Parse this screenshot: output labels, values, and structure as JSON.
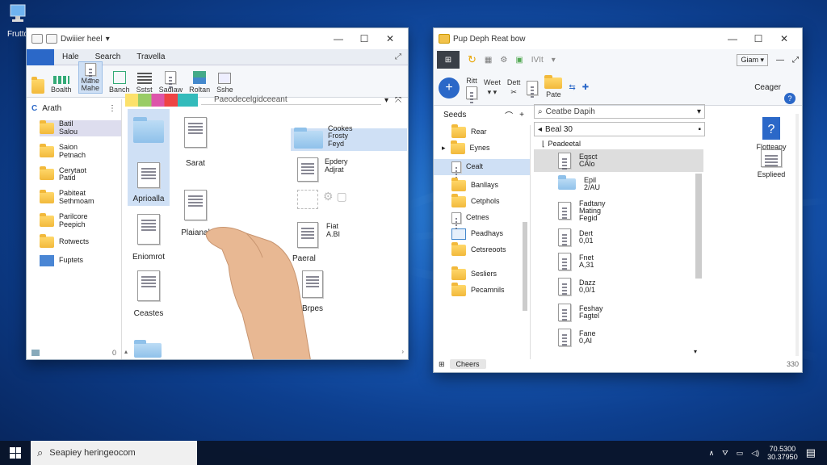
{
  "desktop": {
    "icons": [
      {
        "label": "Fruttd"
      }
    ]
  },
  "left_window": {
    "title": "Dwiiier heel",
    "tabs": [
      "Hale",
      "Search",
      "Travella"
    ],
    "ribbon": [
      "Boalth",
      "Mane\nMahe",
      "Banch",
      "Sstst",
      "Sadlaw",
      "Roltan",
      "Sshe"
    ],
    "address": "Paeodecelgidceeant",
    "nav_header": "Arath",
    "sidebar": [
      "Batil\nSalou",
      "Saion\nPetnach",
      "Cerytaot\nPatid",
      "Pabiteat\nSethmoam",
      "Parilcore\nPeepich",
      "Rotwects",
      "Fuptets"
    ],
    "files": [
      {
        "label": "Aprioalla"
      },
      {
        "label": "Sarat"
      },
      {
        "label": "Plaianal"
      },
      {
        "label": "Eniomrot"
      },
      {
        "label": "Ceastes"
      },
      {
        "label": "Cookes\nFrosty\nFeyd"
      },
      {
        "label": "Epdery\nAdjrat"
      },
      {
        "label": "Fiat\nA.BI"
      },
      {
        "label": "Paeral"
      },
      {
        "label": "Brpes"
      }
    ]
  },
  "right_window": {
    "title": "Pup Deph Reat bow",
    "toolbar": [
      "Ritt",
      "Weet",
      "Dett",
      "Pate",
      "IVIt"
    ],
    "dropdown": "Giam",
    "ceager": "Ceager",
    "nav_header": "Seeds",
    "search_placeholder": "Ceatbe Dapih",
    "path": "Beal 30",
    "tree_header": "Peadeetal",
    "sidebar": [
      "Rear",
      "Eynes",
      "Cealt",
      "Banllays",
      "Cetphols",
      "Cetnes",
      "Peadhays",
      "Cetsreoots",
      "Sesliers",
      "Pecamnils"
    ],
    "files": [
      "Eqsct\nCAlo",
      "Epil\n2/AU",
      "Fadtany\nMating\nFegid",
      "Dert\n0,01",
      "Fnet\nA,31",
      "Dazz\n0,0/1",
      "Feshay\nFagtel",
      "Fane\n0,AI"
    ],
    "desk_icons": [
      "Flotteapy",
      "Esplieed"
    ],
    "status": "Cheers",
    "status_right": "330"
  },
  "taskbar": {
    "search_text": "Seapiey heringeocom",
    "time": "70.5300",
    "date": "30.37950"
  },
  "colors": {
    "accent": "#2b68c8",
    "selection": "#cfe0f5"
  }
}
